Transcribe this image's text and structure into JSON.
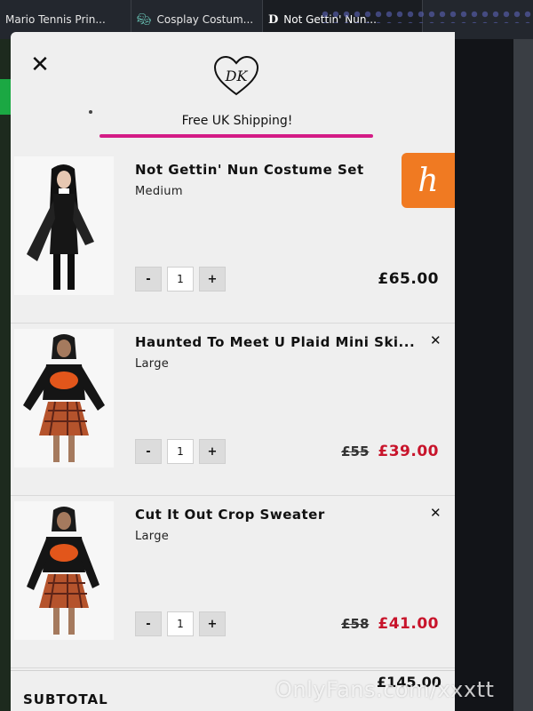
{
  "browser": {
    "tabs": [
      {
        "title": "Mario Tennis Prin...",
        "icon": "mario-icon"
      },
      {
        "title": "Cosplay Costum...",
        "icon": "mask-icon"
      },
      {
        "title": "Not Gettin' Nun...",
        "icon": "dk-icon",
        "active": true
      }
    ]
  },
  "cart": {
    "close_glyph": "✕",
    "logo": "DK",
    "shipping_text": "Free UK Shipping!",
    "accent_color": "#d41c86",
    "sale_color": "#c8142b",
    "items": [
      {
        "name": "Not Gettin' Nun Costume Set",
        "size": "Medium",
        "qty_minus": "-",
        "quantity": "1",
        "qty_plus": "+",
        "old_price": "",
        "price": "£65.00",
        "removable": false
      },
      {
        "name": "Haunted To Meet U Plaid Mini Ski...",
        "size": "Large",
        "qty_minus": "-",
        "quantity": "1",
        "qty_plus": "+",
        "old_price": "£55",
        "price": "£39.00",
        "remove_glyph": "✕",
        "removable": true
      },
      {
        "name": "Cut It Out Crop Sweater",
        "size": "Large",
        "qty_minus": "-",
        "quantity": "1",
        "qty_plus": "+",
        "old_price": "£58",
        "price": "£41.00",
        "remove_glyph": "✕",
        "removable": true
      }
    ],
    "subtotal_label": "SUBTOTAL",
    "subtotal_value": "£145.00"
  },
  "side_widget": {
    "glyph": "h",
    "icon": "honey-extension-icon",
    "color": "#f07a22"
  },
  "watermark": "OnlyFans.com/xxxtt"
}
